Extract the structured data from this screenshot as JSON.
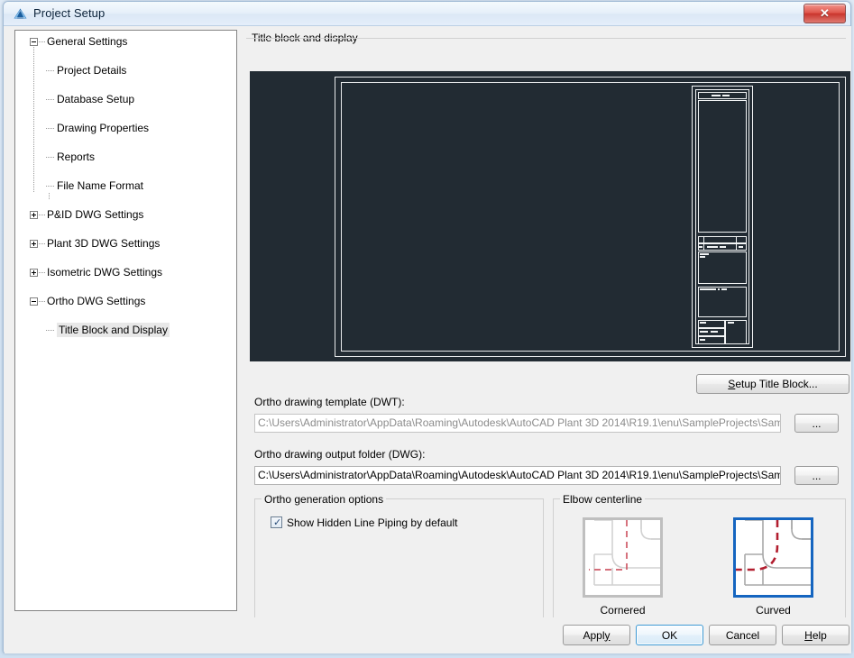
{
  "window": {
    "title": "Project Setup",
    "icon": "autodesk-triangle-icon",
    "close_label": "✕",
    "accent_blue": "#1565c0",
    "canvas_bg": "#222b33"
  },
  "tree": {
    "nodes": [
      {
        "label": "General Settings",
        "level": 0,
        "toggle": "minus",
        "selected": false
      },
      {
        "label": "Project Details",
        "level": 1,
        "toggle": "none",
        "selected": false
      },
      {
        "label": "Database Setup",
        "level": 1,
        "toggle": "none",
        "selected": false
      },
      {
        "label": "Drawing Properties",
        "level": 1,
        "toggle": "none",
        "selected": false
      },
      {
        "label": "Reports",
        "level": 1,
        "toggle": "none",
        "selected": false
      },
      {
        "label": "File Name Format",
        "level": 1,
        "toggle": "none",
        "selected": false
      },
      {
        "label": "P&ID DWG Settings",
        "level": 0,
        "toggle": "plus",
        "selected": false
      },
      {
        "label": "Plant 3D DWG Settings",
        "level": 0,
        "toggle": "plus",
        "selected": false
      },
      {
        "label": "Isometric DWG Settings",
        "level": 0,
        "toggle": "plus",
        "selected": false
      },
      {
        "label": "Ortho DWG Settings",
        "level": 0,
        "toggle": "minus",
        "selected": false
      },
      {
        "label": "Title Block and Display",
        "level": 1,
        "toggle": "none",
        "selected": true
      }
    ]
  },
  "main": {
    "groupbox_title": "Title block and display",
    "setup_title_block_button": "Setup Title Block...",
    "setup_title_block_accesskey": "S",
    "template_label": "Ortho drawing template (DWT):",
    "template_value": "C:\\Users\\Administrator\\AppData\\Roaming\\Autodesk\\AutoCAD Plant 3D 2014\\R19.1\\enu\\SampleProjects\\SampleProject",
    "template_browse_button": "...",
    "template_disabled": true,
    "output_label": "Ortho drawing output folder (DWG):",
    "output_value": "C:\\Users\\Administrator\\AppData\\Roaming\\Autodesk\\AutoCAD Plant 3D 2014\\R19.1\\enu\\SampleProjects\\SampleProject",
    "output_browse_button": "...",
    "output_disabled": false
  },
  "ortho_options": {
    "group_title": "Ortho generation options",
    "checkbox_label": "Show Hidden Line Piping by default",
    "checkbox_checked": true,
    "check_glyph": "✓"
  },
  "elbow_centerline": {
    "group_title": "Elbow centerline",
    "options": [
      {
        "caption": "Cornered",
        "selected": false
      },
      {
        "caption": "Curved",
        "selected": true
      }
    ]
  },
  "footer": {
    "buttons": [
      {
        "label": "Apply",
        "accesskey": "y",
        "default": false
      },
      {
        "label": "OK",
        "accesskey": "",
        "default": true
      },
      {
        "label": "Cancel",
        "accesskey": "",
        "default": false
      },
      {
        "label": "Help",
        "accesskey": "H",
        "default": false
      }
    ]
  }
}
